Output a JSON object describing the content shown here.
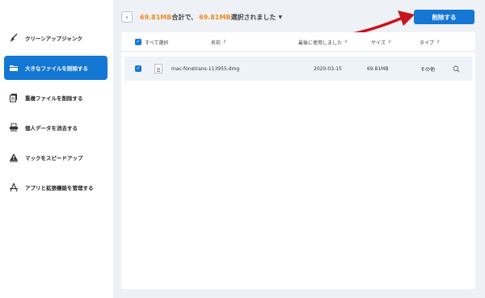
{
  "sidebar": {
    "items": [
      {
        "label": "クリーンアップジャンク",
        "icon": "broom-icon",
        "active": false
      },
      {
        "label": "大きなファイルを削除する",
        "icon": "folder-icon",
        "active": true
      },
      {
        "label": "重複ファイルを削除する",
        "icon": "duplicate-file-icon",
        "active": false
      },
      {
        "label": "個人データを消去する",
        "icon": "shredder-icon",
        "active": false
      },
      {
        "label": "マックをスピードアップ",
        "icon": "warning-icon",
        "active": false
      },
      {
        "label": "アプリと拡張機能を管理する",
        "icon": "app-store-icon",
        "active": false
      }
    ]
  },
  "header": {
    "total_size": "69.81MB",
    "total_text": " 合計で、",
    "selected_size": "69.81MB",
    "selected_text": " 選択されました",
    "delete_label": "削除する"
  },
  "table": {
    "select_all_label": "すべて選択",
    "columns": {
      "name": "名前",
      "last_used": "最後に使用しました",
      "size": "サイズ",
      "type": "タイプ"
    },
    "rows": [
      {
        "name": "mac-fonetrans-113955.dmg",
        "last_used": "2020-03-15",
        "size": "69.81MB",
        "type": "その他",
        "checked": true
      }
    ]
  },
  "colors": {
    "accent": "#1477d3",
    "highlight": "#f08a24",
    "arrow": "#c8141c"
  }
}
